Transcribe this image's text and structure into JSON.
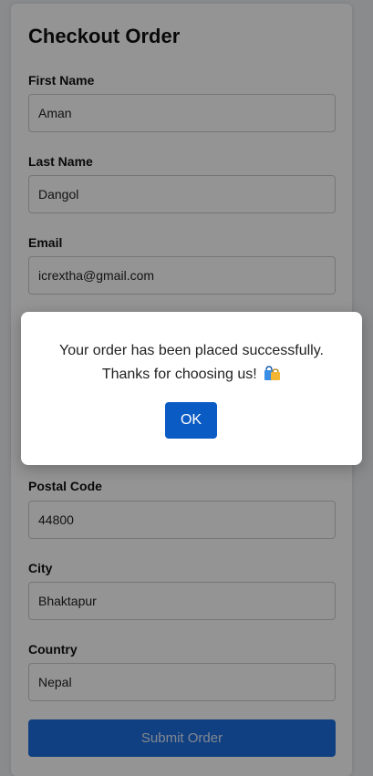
{
  "form": {
    "title": "Checkout Order",
    "fields": [
      {
        "label": "First Name",
        "value": "Aman"
      },
      {
        "label": "Last Name",
        "value": "Dangol"
      },
      {
        "label": "Email",
        "value": "icrextha@gmail.com"
      },
      {
        "label": "Postal Code",
        "value": "44800"
      },
      {
        "label": "City",
        "value": "Bhaktapur"
      },
      {
        "label": "Country",
        "value": "Nepal"
      }
    ],
    "submit_label": "Submit Order"
  },
  "modal": {
    "message_line1": "Your order has been placed successfully.",
    "message_line2": "Thanks for choosing us!",
    "emoji_icon": "shopping-bags-icon",
    "ok_label": "OK"
  },
  "colors": {
    "primary": "#1e6fe0",
    "modal_button": "#0a5bc4",
    "overlay": "rgba(0,0,0,0.42)"
  }
}
